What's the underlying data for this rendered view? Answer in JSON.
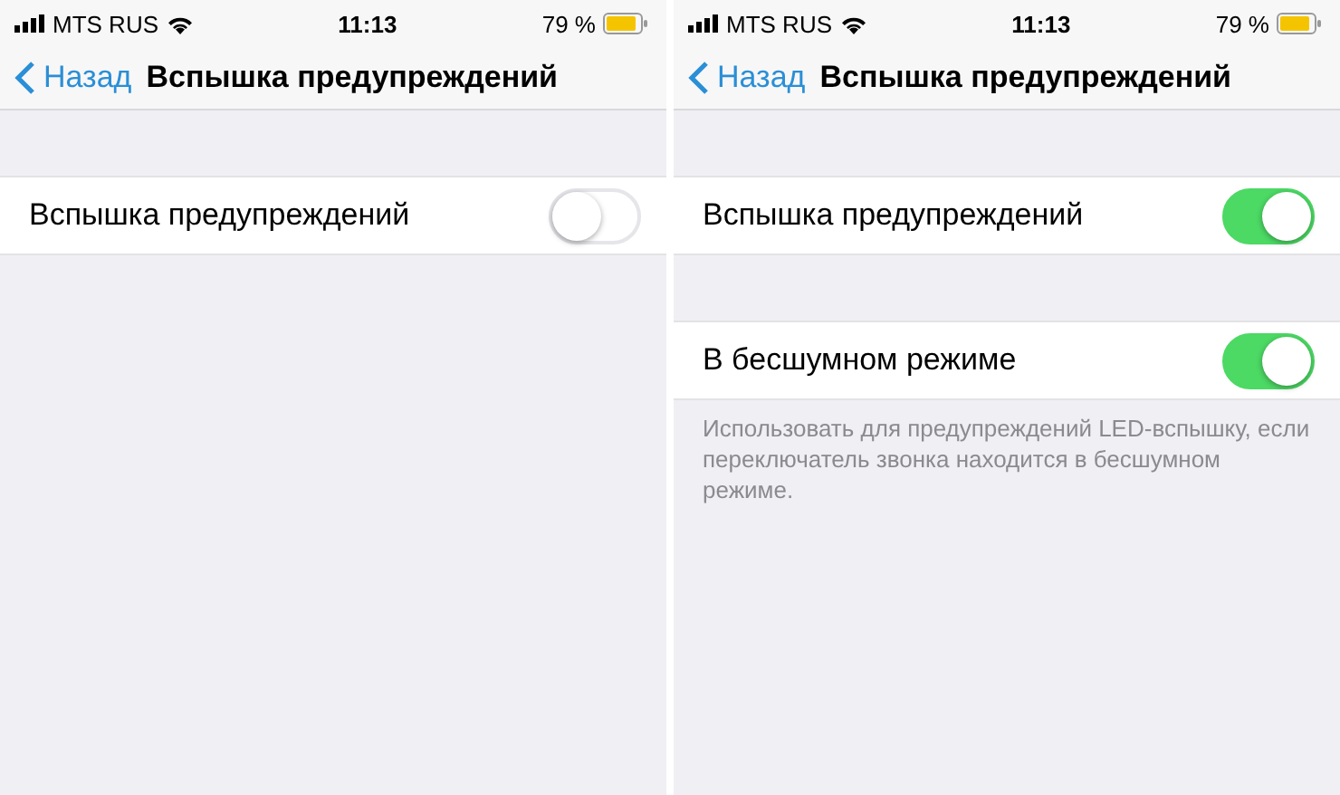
{
  "screens": [
    {
      "status_bar": {
        "carrier": "MTS RUS",
        "time": "11:13",
        "battery": "79 %"
      },
      "nav_bar": {
        "back": "Назад",
        "title": "Вспышка предупреждений"
      },
      "sections": [
        {
          "rows": [
            {
              "label": "Вспышка предупреждений",
              "on": false
            }
          ]
        }
      ]
    },
    {
      "status_bar": {
        "carrier": "MTS RUS",
        "time": "11:13",
        "battery": "79 %"
      },
      "nav_bar": {
        "back": "Назад",
        "title": "Вспышка предупреждений"
      },
      "sections": [
        {
          "rows": [
            {
              "label": "Вспышка предупреждений",
              "on": true
            }
          ]
        },
        {
          "rows": [
            {
              "label": "В бесшумном режиме",
              "on": true
            }
          ],
          "footer": "Использовать для предупреждений LED-вспышку, если переключатель звонка находится в бесшумном режиме."
        }
      ]
    }
  ]
}
